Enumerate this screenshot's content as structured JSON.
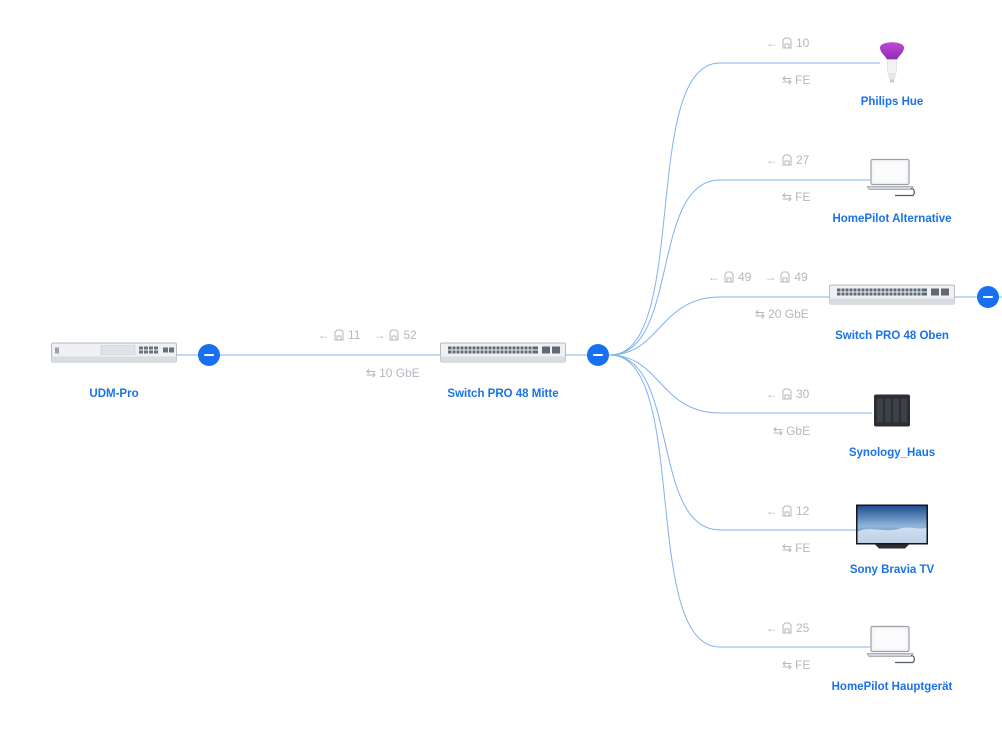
{
  "nodes": {
    "udm_pro": {
      "label": "UDM-Pro",
      "icon": "rack-gateway-icon"
    },
    "switch_mitte": {
      "label": "Switch PRO 48 Mitte",
      "icon": "switch-48-icon"
    },
    "philips_hue": {
      "label": "Philips Hue",
      "icon": "smart-bulb-icon"
    },
    "homepilot_alt": {
      "label": "HomePilot Alternative",
      "icon": "laptop-icon"
    },
    "switch_oben": {
      "label": "Switch PRO 48 Oben",
      "icon": "switch-48-icon"
    },
    "synology": {
      "label": "Synology_Haus",
      "icon": "nas-icon"
    },
    "sony_tv": {
      "label": "Sony Bravia TV",
      "icon": "tv-icon"
    },
    "homepilot_main": {
      "label": "HomePilot Hauptgerät",
      "icon": "laptop-icon"
    }
  },
  "links": {
    "udm_to_mitte": {
      "port_in": "11",
      "port_out": "52",
      "speed": "10 GbE"
    },
    "hue": {
      "port_in": "10",
      "speed": "FE"
    },
    "homepilot_alt": {
      "port_in": "27",
      "speed": "FE"
    },
    "oben": {
      "port_in": "49",
      "port_out": "49",
      "speed": "20 GbE"
    },
    "synology": {
      "port_in": "30",
      "speed": "GbE"
    },
    "sony": {
      "port_in": "12",
      "speed": "FE"
    },
    "homepilot_main": {
      "port_in": "25",
      "speed": "FE"
    }
  },
  "colors": {
    "link_line": "#7fb2ef",
    "accent": "#1670f0",
    "label": "#1a73e8",
    "port_text": "#b3b8bf"
  }
}
